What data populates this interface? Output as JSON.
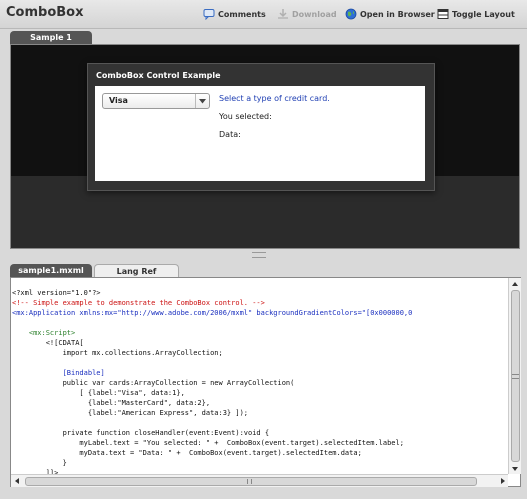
{
  "app": {
    "title": "ComboBox"
  },
  "toolbar": {
    "comments": {
      "label": "Comments",
      "icon": "comment-icon"
    },
    "download": {
      "label": "Download",
      "icon": "download-icon",
      "enabled": false
    },
    "open_browser": {
      "label": "Open in Browser",
      "icon": "globe-icon"
    },
    "toggle_layout": {
      "label": "Toggle Layout",
      "icon": "layout-icon"
    }
  },
  "preview": {
    "tab_label": "Sample 1",
    "panel_title": "ComboBox Control Example",
    "combo_value": "Visa",
    "prompt": "Select a type of credit card.",
    "selected_label": "You selected:",
    "data_label": "Data:"
  },
  "source": {
    "tabs": [
      "sample1.mxml",
      "Lang Ref"
    ],
    "lines": [
      {
        "text": "<?xml version=\"1.0\"?>",
        "color": "plain"
      },
      {
        "text": "<!-- Simple example to demonstrate the ComboBox control. -->",
        "color": "red"
      },
      {
        "text": "<mx:Application xmlns:mx=\"http://www.adobe.com/2006/mxml\" backgroundGradientColors=\"[0x000000,0",
        "color": "blue"
      },
      {
        "text": "",
        "color": "plain"
      },
      {
        "text": "    <mx:Script>",
        "color": "green"
      },
      {
        "text": "        <![CDATA[",
        "color": "plain"
      },
      {
        "text": "            import mx.collections.ArrayCollection;",
        "color": "plain"
      },
      {
        "text": "",
        "color": "plain"
      },
      {
        "text": "            [Bindable]",
        "color": "blue"
      },
      {
        "text": "            public var cards:ArrayCollection = new ArrayCollection(",
        "color": "plain"
      },
      {
        "text": "                [ {label:\"Visa\", data:1},",
        "color": "plain"
      },
      {
        "text": "                  {label:\"MasterCard\", data:2},",
        "color": "plain"
      },
      {
        "text": "                  {label:\"American Express\", data:3} ]);",
        "color": "plain"
      },
      {
        "text": "",
        "color": "plain"
      },
      {
        "text": "            private function closeHandler(event:Event):void {",
        "color": "plain"
      },
      {
        "text": "                myLabel.text = \"You selected: \" +  ComboBox(event.target).selectedItem.label;",
        "color": "plain"
      },
      {
        "text": "                myData.text = \"Data: \" +  ComboBox(event.target).selectedItem.data;",
        "color": "plain"
      },
      {
        "text": "            }",
        "color": "plain"
      },
      {
        "text": "        ]]>",
        "color": "plain"
      }
    ]
  },
  "colors": {
    "accent_blue": "#1f3fb3",
    "code_red": "#cc1111",
    "code_blue": "#1a2fbf",
    "code_green": "#2a7f2a"
  }
}
